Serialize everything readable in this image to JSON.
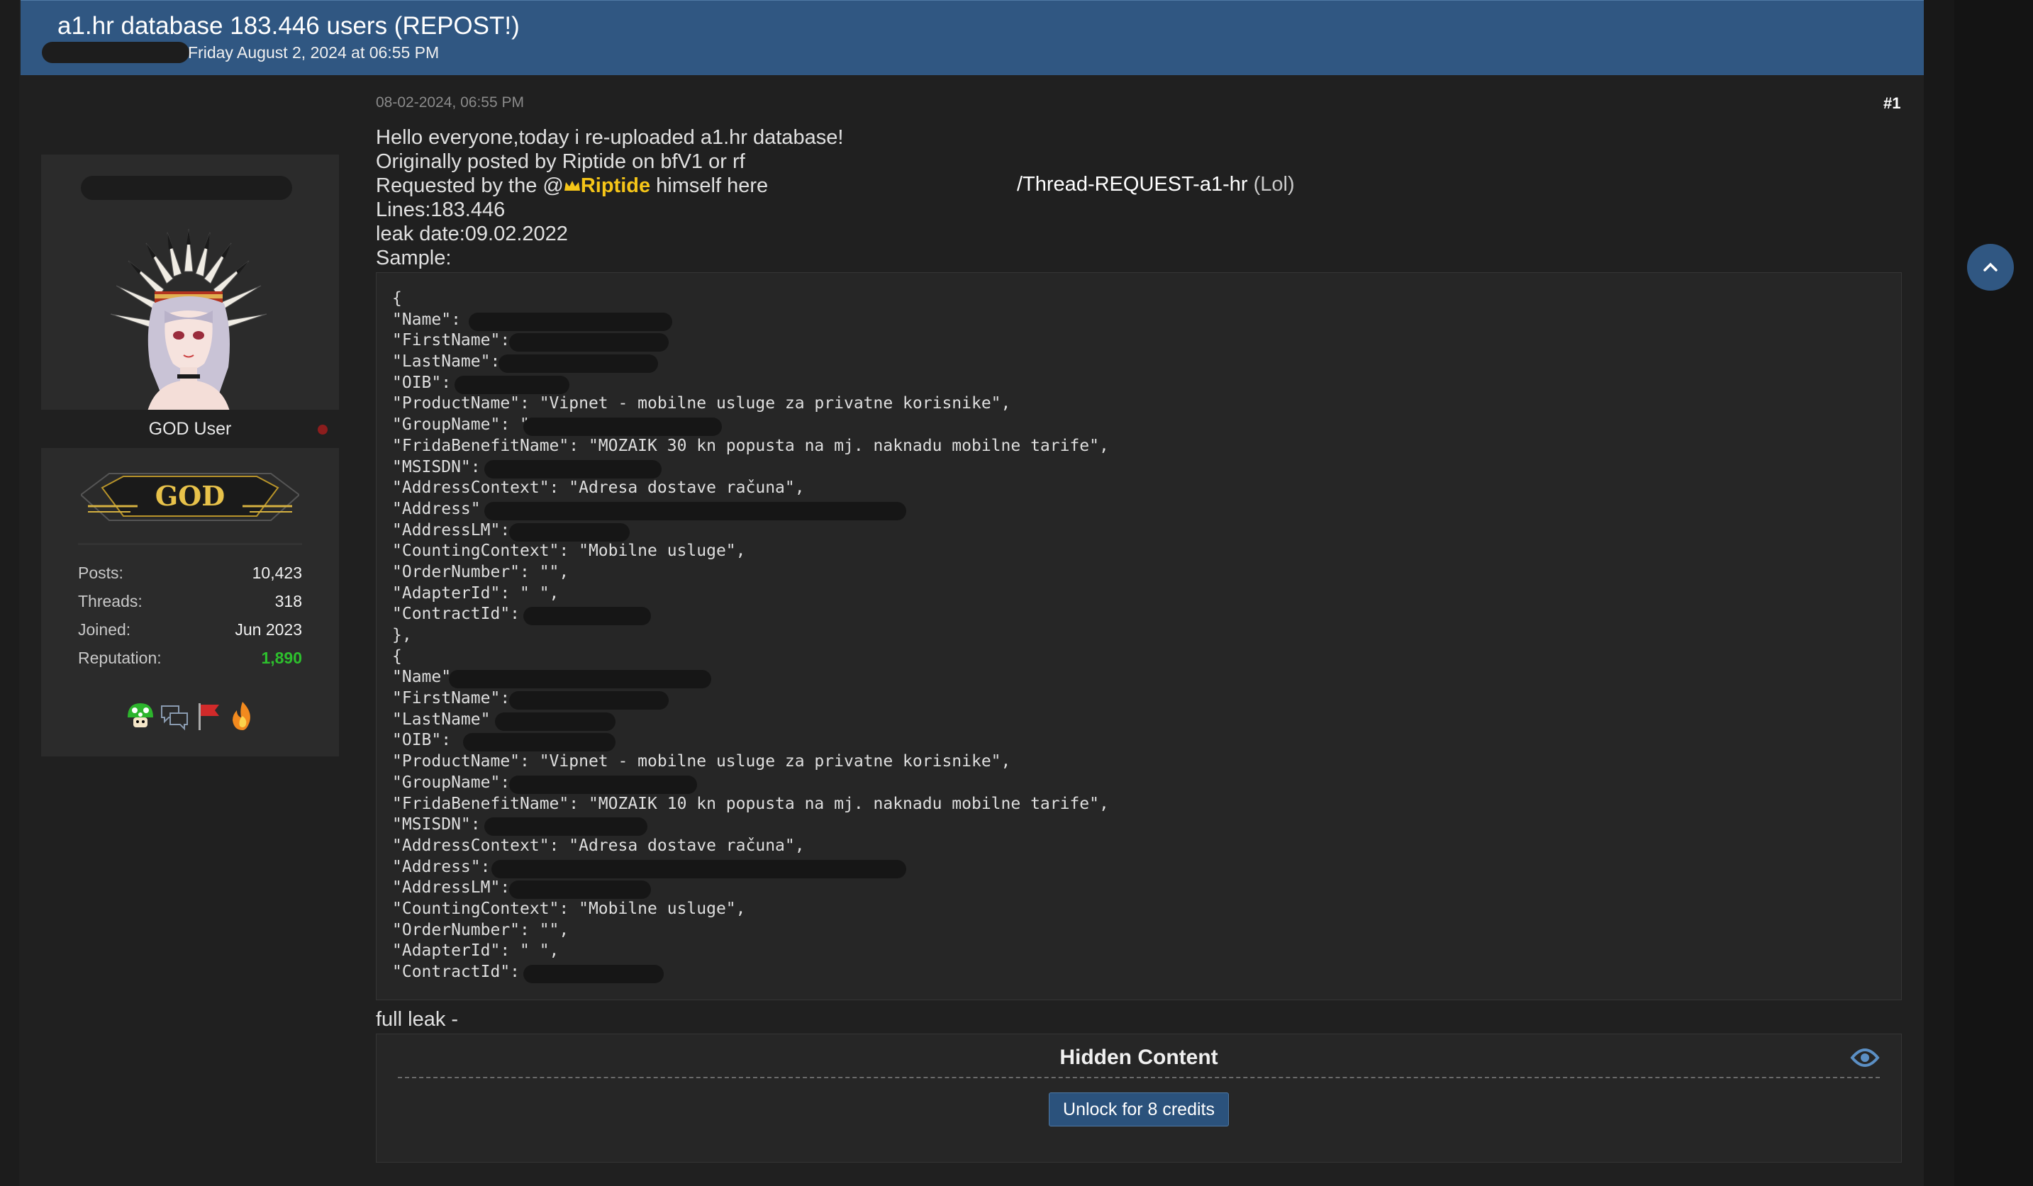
{
  "thread": {
    "title": "a1.hr database 183.446 users (REPOST!)",
    "date": "Friday August 2, 2024 at 06:55 PM"
  },
  "user": {
    "role": "GOD User",
    "rank_badge_text": "GOD",
    "stats": [
      {
        "label": "Posts:",
        "value": "10,423"
      },
      {
        "label": "Threads:",
        "value": "318"
      },
      {
        "label": "Joined:",
        "value": "Jun 2023"
      },
      {
        "label": "Reputation:",
        "value": "1,890"
      }
    ],
    "awards": [
      "mushroom-icon",
      "chat-icon",
      "flag-icon",
      "fire-icon"
    ]
  },
  "post": {
    "date": "08-02-2024, 06:55 PM",
    "number": "#1",
    "lines": [
      "Hello everyone,today i re-uploaded a1.hr database!",
      "Originally posted by Riptide on bfV1 or rf"
    ],
    "requested_prefix": "Requested by the @",
    "mention_icon": "crown-icon",
    "mention": "Riptide",
    "requested_suffix": " himself here",
    "thread_link": "/Thread-REQUEST-a1-hr",
    "thread_link_suffix": " (Lol)",
    "lines_after": [
      "Lines:183.446",
      "leak date:09.02.2022",
      "Sample:"
    ],
    "code_lines": [
      "{",
      "\"Name\":",
      "\"FirstName\":",
      "\"LastName\":",
      "\"OIB\":",
      "\"ProductName\": \"Vipnet - mobilne usluge za privatne korisnike\",",
      "\"GroupName\": \"",
      "\"FridaBenefitName\": \"MOZAIK 30 kn popusta na mj. naknadu mobilne tarife\",",
      "\"MSISDN\":",
      "\"AddressContext\": \"Adresa dostave računa\",",
      "\"Address\"",
      "\"AddressLM\":",
      "\"CountingContext\": \"Mobilne usluge\",",
      "\"OrderNumber\": \"\",",
      "\"AdapterId\": \" \",",
      "\"ContractId\":",
      "},",
      "{",
      "\"Name\"",
      "\"FirstName\":",
      "\"LastName\"",
      "\"OIB\":",
      "\"ProductName\": \"Vipnet - mobilne usluge za privatne korisnike\",",
      "\"GroupName\":",
      "\"FridaBenefitName\": \"MOZAIK 10 kn popusta na mj. naknadu mobilne tarife\",",
      "\"MSISDN\":",
      "\"AddressContext\": \"Adresa dostave računa\",",
      "\"Address\":",
      "\"AddressLM\":",
      "\"CountingContext\": \"Mobilne usluge\",",
      "\"OrderNumber\": \"\",",
      "\"AdapterId\": \" \",",
      "\"ContractId\":"
    ],
    "full_leak_label": "full leak -",
    "hidden_content": {
      "title": "Hidden Content",
      "unlock_label": "Unlock for 8 credits"
    }
  },
  "colors": {
    "header_bg": "#305782",
    "page_bg": "#202020",
    "mention": "#f5c518",
    "reputation": "#2dbf2d"
  }
}
